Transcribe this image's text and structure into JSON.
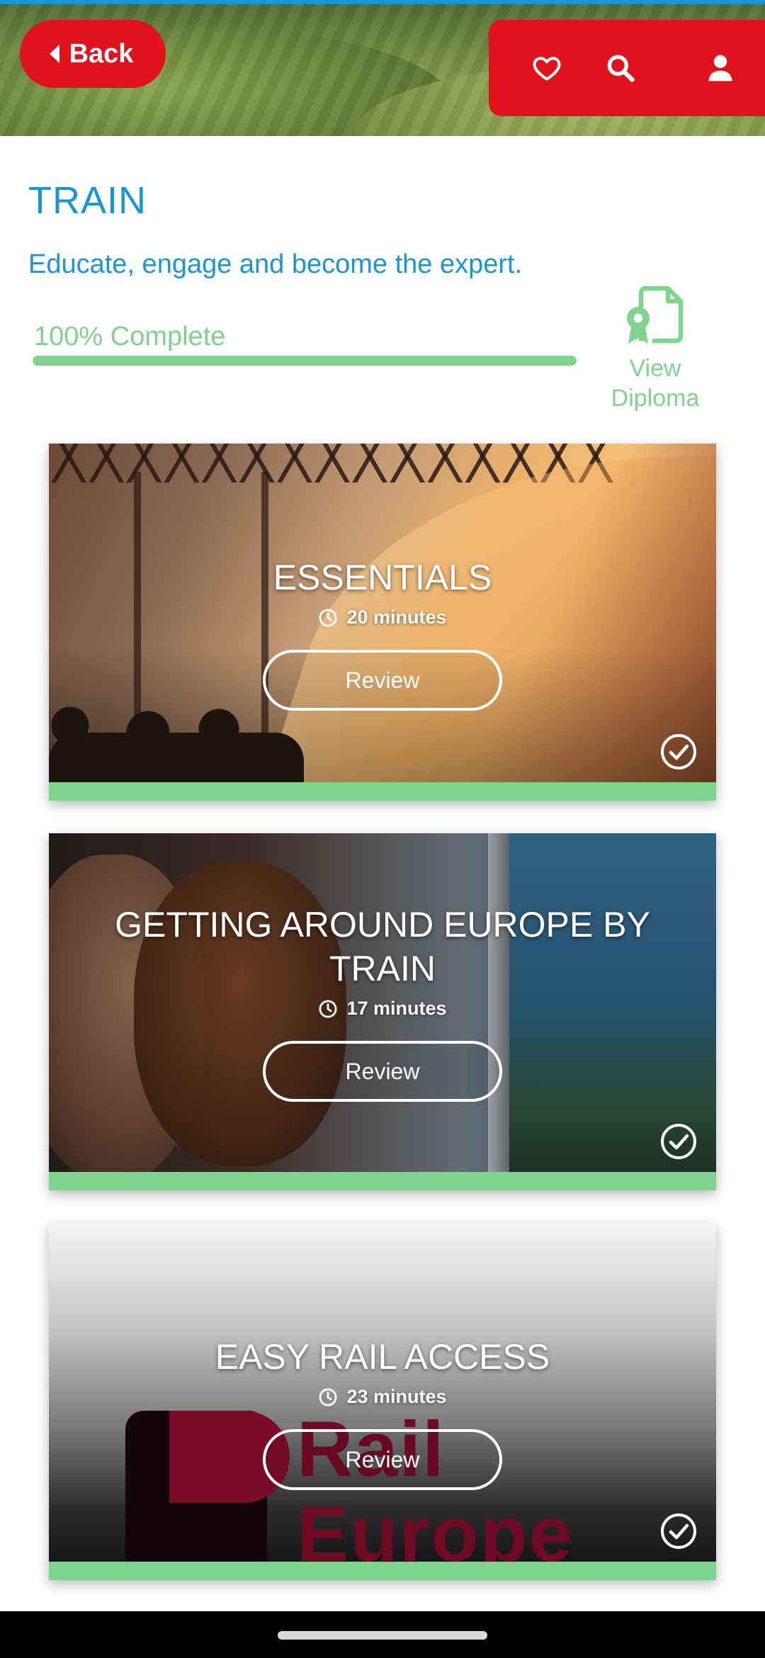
{
  "header": {
    "back_label": "Back",
    "icons": [
      "heart-icon",
      "search-icon",
      "user-icon"
    ],
    "accent": "#e0121b"
  },
  "page": {
    "title": "TRAIN",
    "subtitle": "Educate, engage and become the expert.",
    "title_color": "#1a96d4"
  },
  "progress": {
    "label": "100% Complete",
    "percent": 100,
    "color": "#7fd48d"
  },
  "diploma": {
    "label_line1": "View",
    "label_line2": "Diploma"
  },
  "modules": [
    {
      "title": "ESSENTIALS",
      "duration": "20 minutes",
      "button": "Review",
      "completed": true
    },
    {
      "title": "GETTING AROUND EUROPE BY TRAIN",
      "duration": "17 minutes",
      "button": "Review",
      "completed": true
    },
    {
      "title": "EASY RAIL ACCESS",
      "duration": "23 minutes",
      "button": "Review",
      "completed": true
    }
  ],
  "card3_logo": {
    "line1": "Rail",
    "line2": "Europe"
  }
}
